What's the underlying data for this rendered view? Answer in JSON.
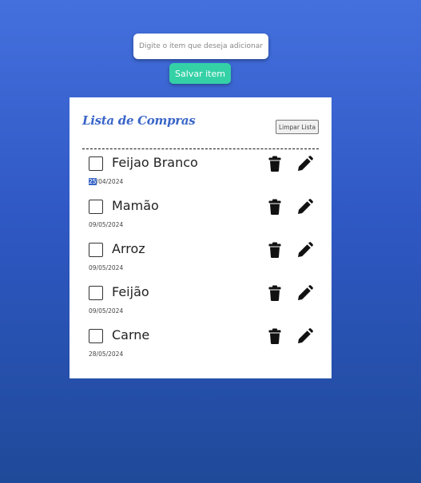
{
  "add_form": {
    "placeholder": "Digite o item que deseja adicionar",
    "save_label": "Salvar item"
  },
  "card": {
    "title": "Lista de Compras",
    "clear_label": "Limpar Lista"
  },
  "items": [
    {
      "name": "Feijao Branco",
      "date_prefix": "25",
      "date_rest": "/04/2024",
      "checked": false
    },
    {
      "name": "Mamão",
      "date_prefix": "",
      "date_rest": "09/05/2024",
      "checked": false
    },
    {
      "name": "Arroz",
      "date_prefix": "",
      "date_rest": "09/05/2024",
      "checked": false
    },
    {
      "name": "Feijão",
      "date_prefix": "",
      "date_rest": "09/05/2024",
      "checked": false
    },
    {
      "name": "Carne",
      "date_prefix": "",
      "date_rest": "28/05/2024",
      "checked": false
    }
  ],
  "icons": {
    "delete": "trash-icon",
    "edit": "pencil-icon"
  },
  "colors": {
    "accent": "#3a66c8",
    "save_button": "#34d1a6",
    "background_top": "#4470dd",
    "background_bottom": "#1f4a99"
  }
}
